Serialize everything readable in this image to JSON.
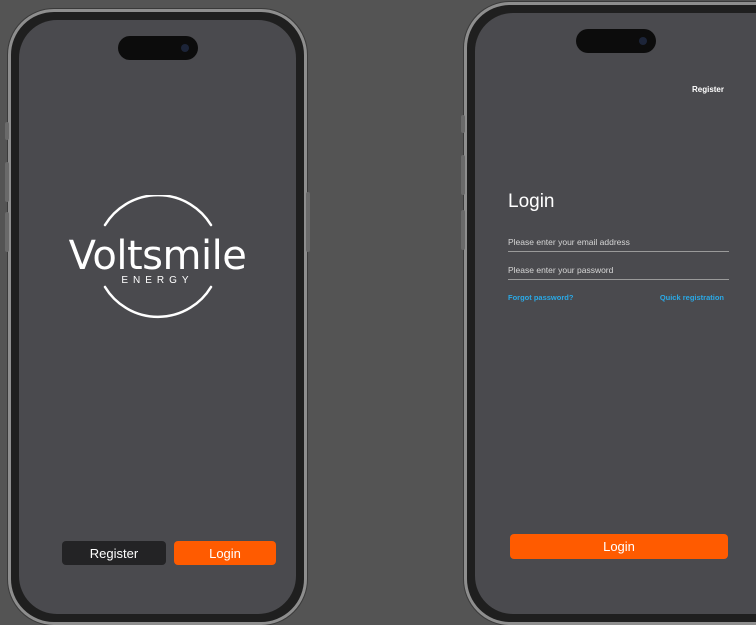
{
  "splash": {
    "logo_word": "Voltsmile",
    "logo_sub": "ENERGY",
    "register_label": "Register",
    "login_label": "Login"
  },
  "login_screen": {
    "top_register_label": "Register",
    "title": "Login",
    "email_placeholder": "Please enter your email address",
    "password_placeholder": "Please enter your password",
    "forgot_password_label": "Forgot password?",
    "quick_registration_label": "Quick registration",
    "login_button_label": "Login"
  },
  "colors": {
    "accent": "#ff5b00",
    "link": "#2aa9e6",
    "screen_bg": "#4a4a4e",
    "page_bg": "#545454"
  }
}
